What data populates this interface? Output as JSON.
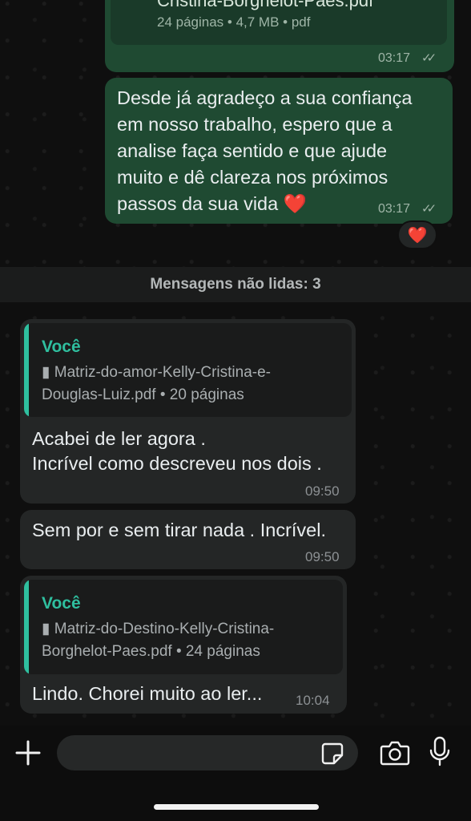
{
  "messages": {
    "prev_doc": {
      "name": "Cristina-Borghelot-Paes.pdf",
      "meta": "24 páginas • 4,7 MB • pdf",
      "time": "03:17"
    },
    "thank_you": {
      "line1": "Desde já agradeço a sua confiança",
      "line2": "em nosso trabalho, espero que a",
      "line3": "analise faça sentido e que ajude",
      "line4": "muito e dê clareza nos próximos",
      "line5": "passos da sua vida ❤️",
      "time": "03:17",
      "reaction": "❤️"
    },
    "unread_label": "Mensagens não lidas: 3",
    "reply1": {
      "quote_author": "Você",
      "quote_file_line1": "Matriz-do-amor-Kelly-Cristina-e-",
      "quote_file_line2": "Douglas-Luiz.pdf • 20 páginas",
      "line1": "Acabei de ler agora .",
      "line2": "Incrível como descreveu nos dois .",
      "time": "09:50"
    },
    "reply2": {
      "text": "Sem por e sem tirar nada . Incrível.",
      "time": "09:50"
    },
    "reply3": {
      "quote_author": "Você",
      "quote_file_line1": "Matriz-do-Destino-Kelly-Cristina-",
      "quote_file_line2": "Borghelot-Paes.pdf • 24 páginas",
      "text": "Lindo. Chorei muito ao ler...",
      "time": "10:04"
    }
  },
  "composer": {
    "icons": [
      "plus-icon",
      "sticker-icon",
      "camera-icon",
      "microphone-icon"
    ]
  },
  "colors": {
    "outgoing_bubble": "#1f4a32",
    "incoming_bubble": "#242626",
    "quote_accent": "#2fbf9f"
  }
}
